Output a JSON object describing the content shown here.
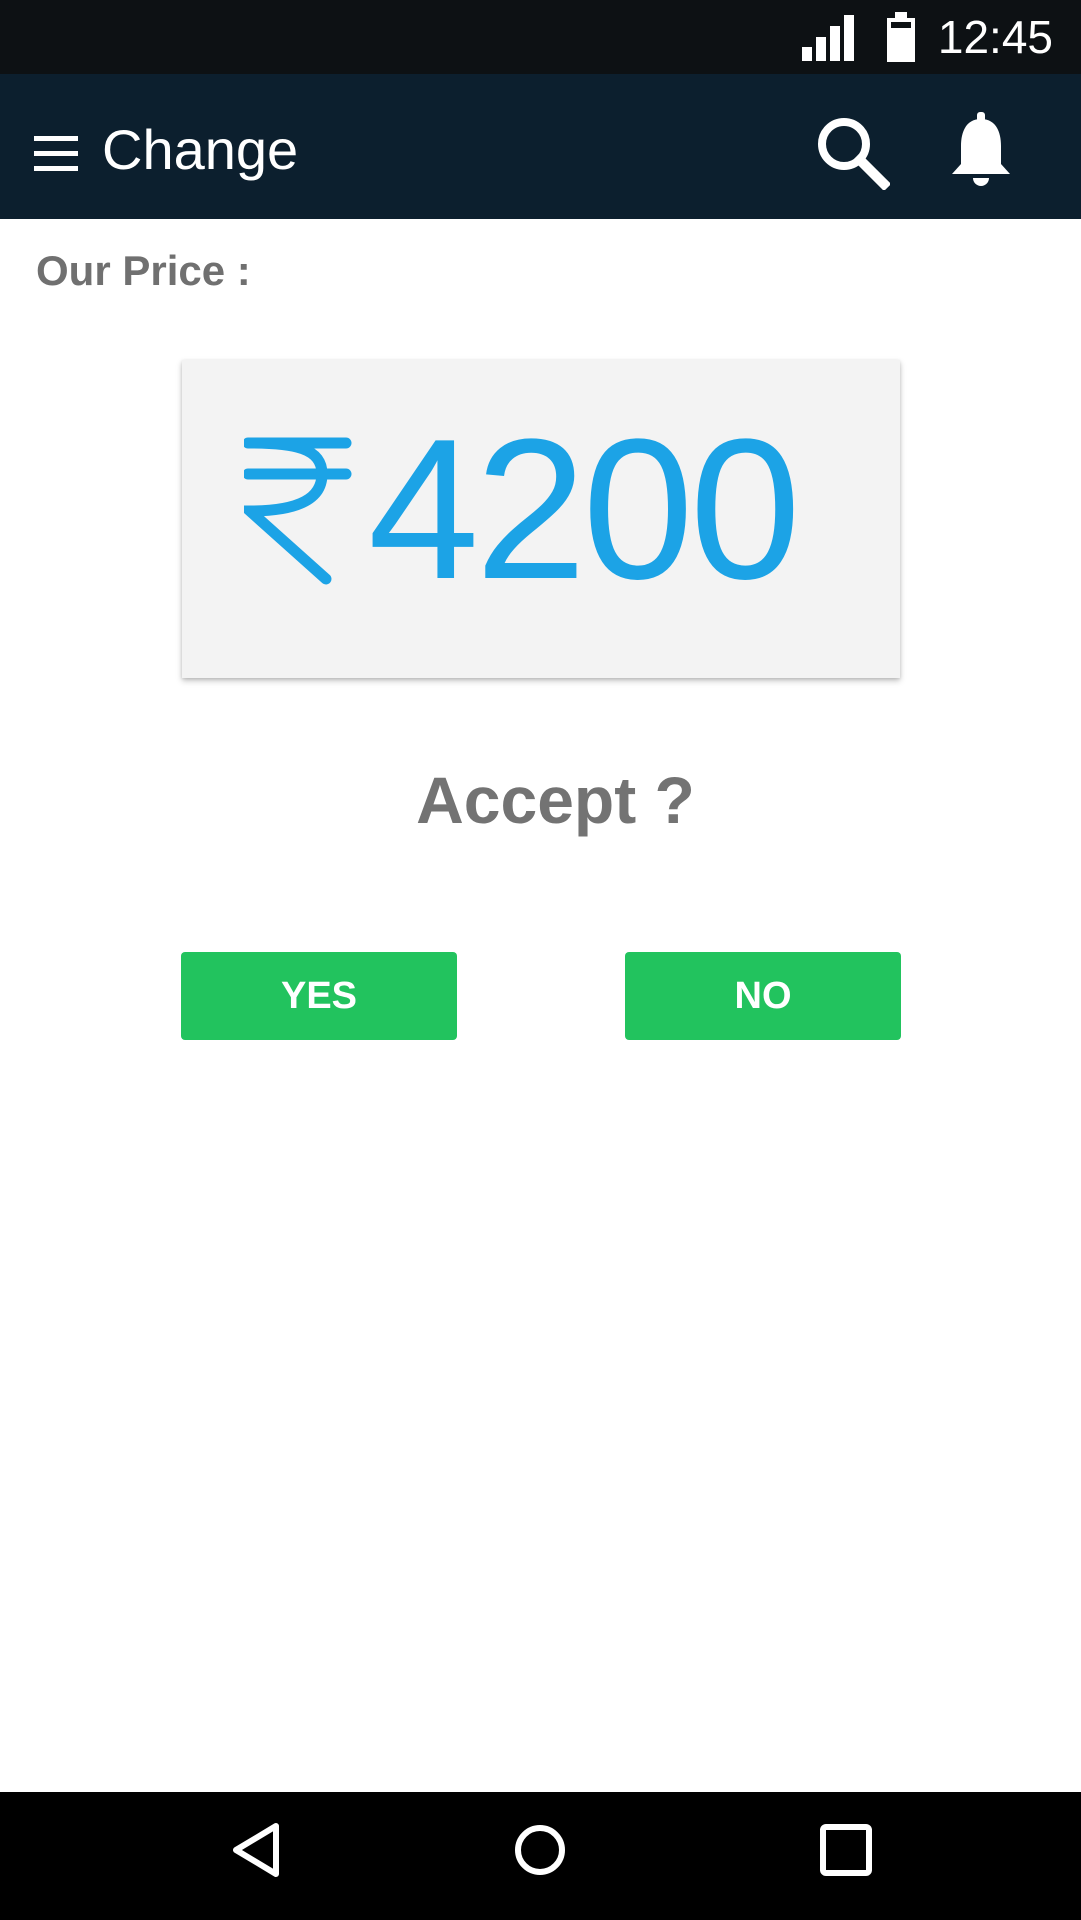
{
  "status_bar": {
    "time": "12:45"
  },
  "app_bar": {
    "title": "Change",
    "icons": [
      "menu-icon",
      "search-icon",
      "bell-icon"
    ]
  },
  "price": {
    "label": "Our Price :",
    "currency_icon": "rupee-icon",
    "value": "4200"
  },
  "accept": {
    "question": "Accept ?"
  },
  "buttons": {
    "yes_label": "YES",
    "no_label": "NO"
  },
  "nav_bar": {
    "icons": [
      "back-icon",
      "home-icon",
      "recents-icon"
    ]
  },
  "colors": {
    "status_bar": "#0d1114",
    "app_bar": "#0c1f2e",
    "price_text": "#1ca3e6",
    "button": "#22c35e",
    "label_text": "#707070"
  }
}
